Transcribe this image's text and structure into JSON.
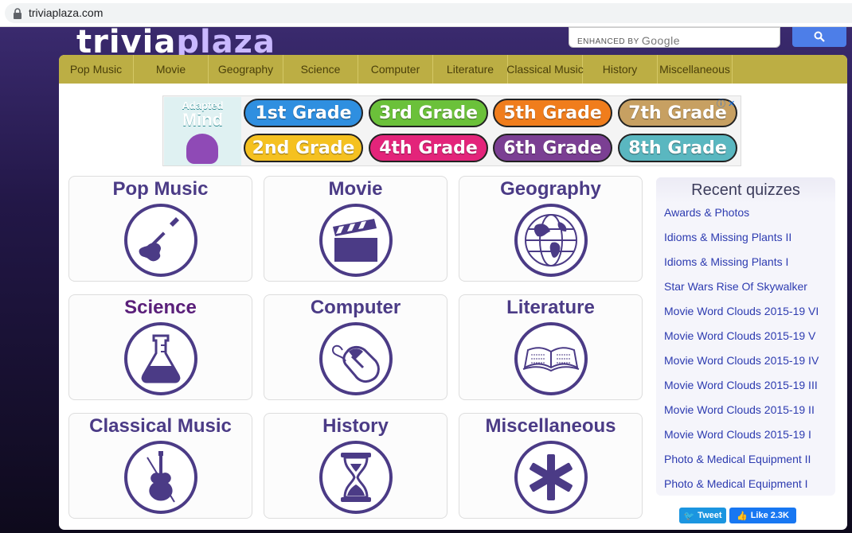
{
  "browser": {
    "url": "triviaplaza.com"
  },
  "site": {
    "logo_part1": "trivia",
    "logo_part2": "plaza"
  },
  "search": {
    "enhanced_by": "ENHANCED BY",
    "google": "Google"
  },
  "nav": [
    "Pop Music",
    "Movie",
    "Geography",
    "Science",
    "Computer",
    "Literature",
    "Classical Music",
    "History",
    "Miscellaneous"
  ],
  "ad": {
    "brand_line1": "Adapted",
    "brand_line2": "Mind",
    "grades_top": [
      "1st Grade",
      "3rd Grade",
      "5th Grade",
      "7th Grade"
    ],
    "grades_bottom": [
      "2nd Grade",
      "4th Grade",
      "6th Grade",
      "8th Grade"
    ],
    "colors_top": [
      "#2f8fe0",
      "#6bc13a",
      "#f07d1c",
      "#c7a062"
    ],
    "colors_bottom": [
      "#f5c120",
      "#e3247a",
      "#7b3f93",
      "#5ab7c0"
    ]
  },
  "categories": [
    {
      "title": "Pop Music",
      "icon": "guitar-icon"
    },
    {
      "title": "Movie",
      "icon": "clapperboard-icon"
    },
    {
      "title": "Geography",
      "icon": "globe-icon"
    },
    {
      "title": "Science",
      "icon": "flask-icon"
    },
    {
      "title": "Computer",
      "icon": "mouse-icon"
    },
    {
      "title": "Literature",
      "icon": "book-icon"
    },
    {
      "title": "Classical Music",
      "icon": "violin-icon"
    },
    {
      "title": "History",
      "icon": "hourglass-icon"
    },
    {
      "title": "Miscellaneous",
      "icon": "asterisk-icon"
    }
  ],
  "recent": {
    "heading": "Recent quizzes",
    "items": [
      "Awards & Photos",
      "Idioms & Missing Plants II",
      "Idioms & Missing Plants I",
      "Star Wars Rise Of Skywalker",
      "Movie Word Clouds 2015-19 VI",
      "Movie Word Clouds 2015-19 V",
      "Movie Word Clouds 2015-19 IV",
      "Movie Word Clouds 2015-19 III",
      "Movie Word Clouds 2015-19 II",
      "Movie Word Clouds 2015-19 I",
      "Photo & Medical Equipment II",
      "Photo & Medical Equipment I"
    ]
  },
  "social": {
    "tweet": "Tweet",
    "like": "Like 2.3K"
  },
  "colors": {
    "nav_bg": "#bcae44",
    "title": "#4b3b86",
    "science_title": "#5a1f7a",
    "link": "#2d3bb0"
  }
}
